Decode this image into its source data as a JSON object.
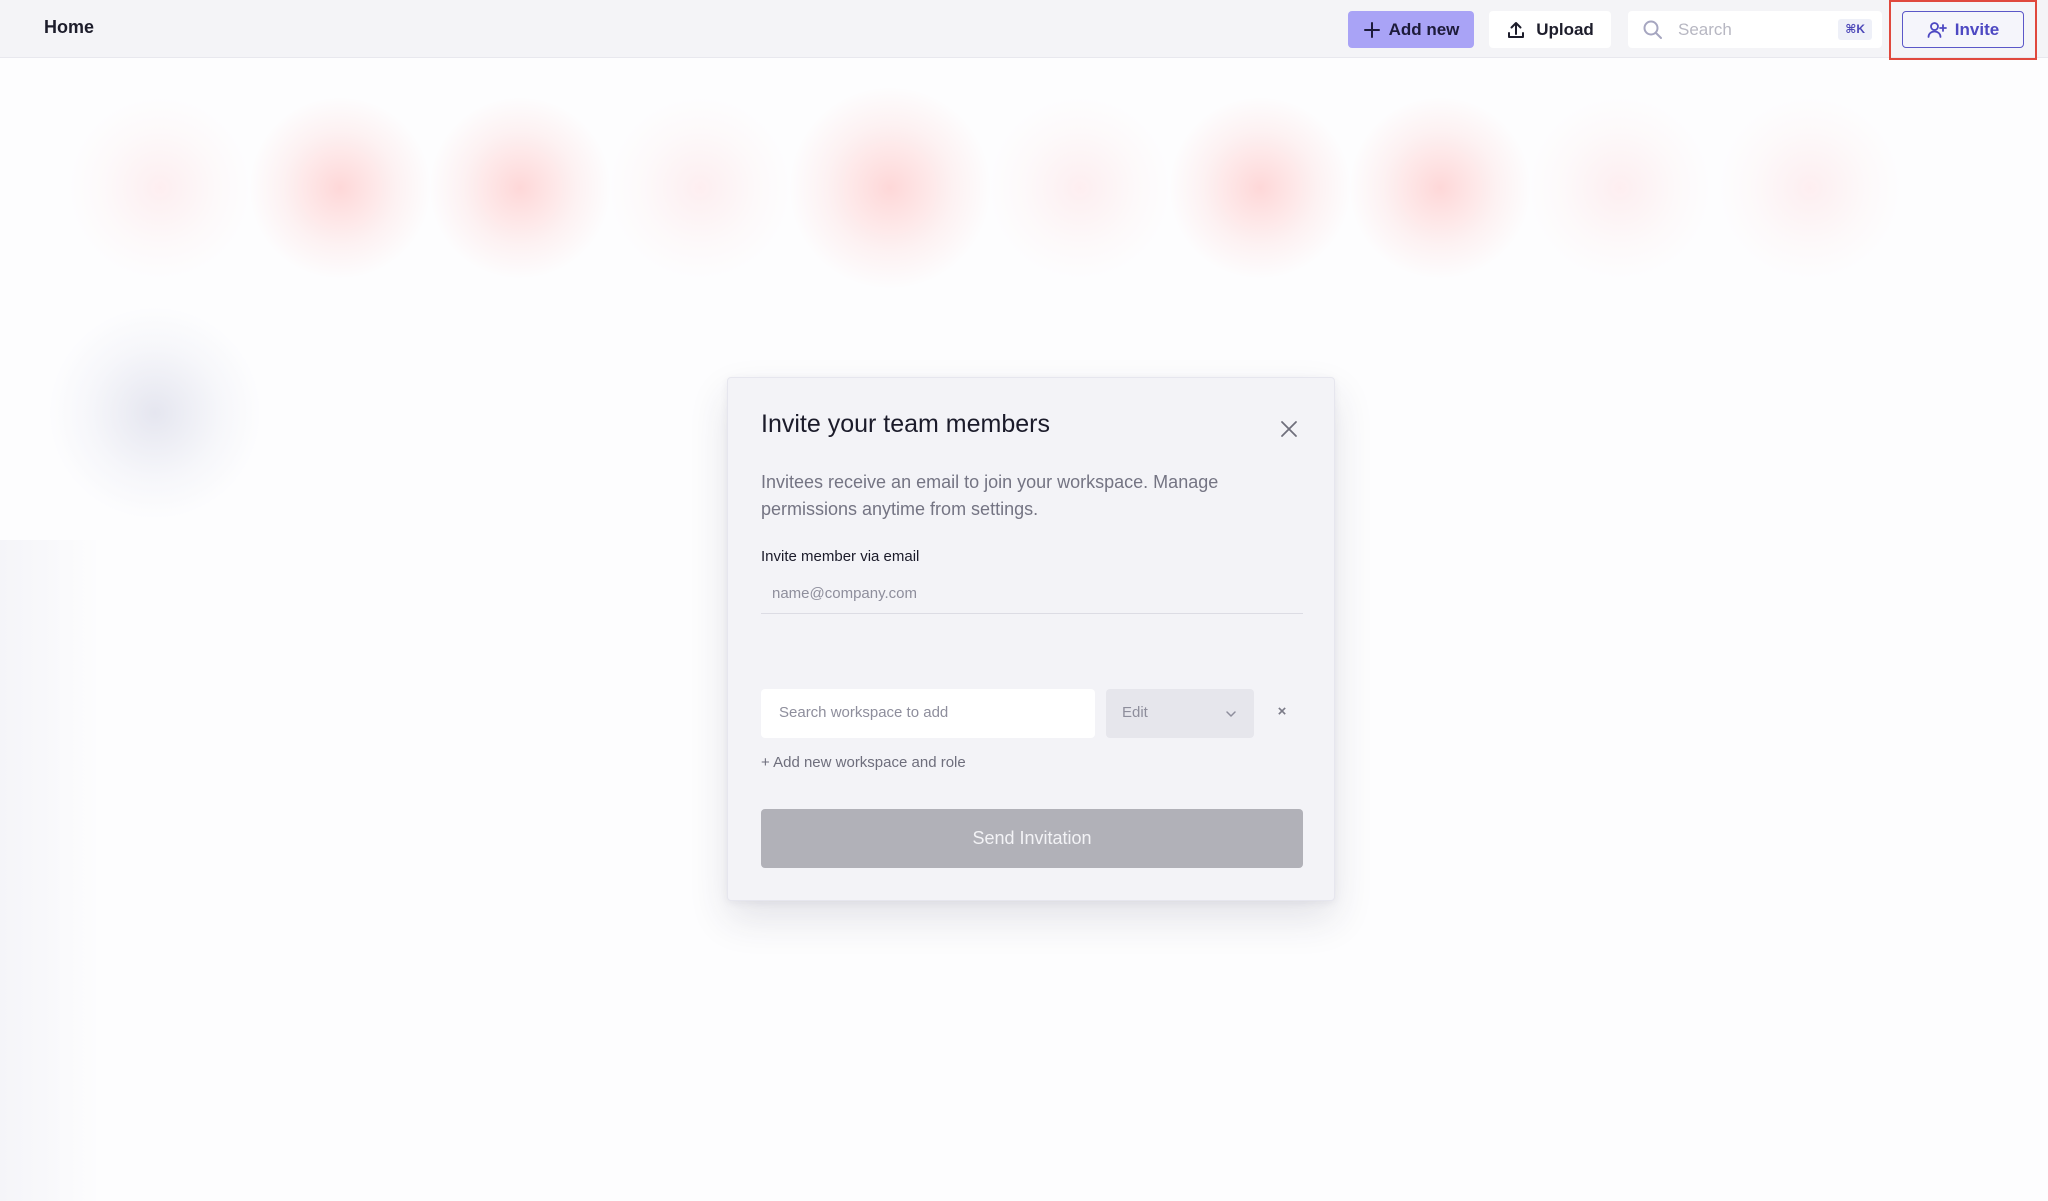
{
  "topbar": {
    "title": "Home",
    "add_new_label": "Add new",
    "upload_label": "Upload",
    "search_placeholder": "Search",
    "search_shortcut": "⌘K",
    "invite_label": "Invite",
    "add_new_color": "#a9a3f6",
    "invite_accent": "#4d48c2",
    "highlight_color": "#e0483c"
  },
  "modal": {
    "title": "Invite your team members",
    "description": "Invitees receive an email to join your workspace. Manage permissions anytime from settings.",
    "email_label": "Invite member via email",
    "email_placeholder": "name@company.com",
    "workspace_placeholder": "Search workspace to add",
    "role_value": "Edit",
    "remove_symbol": "×",
    "add_workspace_label": "+ Add new workspace and role",
    "send_label": "Send Invitation",
    "send_disabled_color": "#b1b1b8"
  },
  "icons": {
    "add_new": "plus-icon",
    "upload": "upload-icon",
    "search": "search-icon",
    "invite": "add-user-icon",
    "close": "close-icon",
    "role_dropdown": "chevron-down-icon"
  }
}
